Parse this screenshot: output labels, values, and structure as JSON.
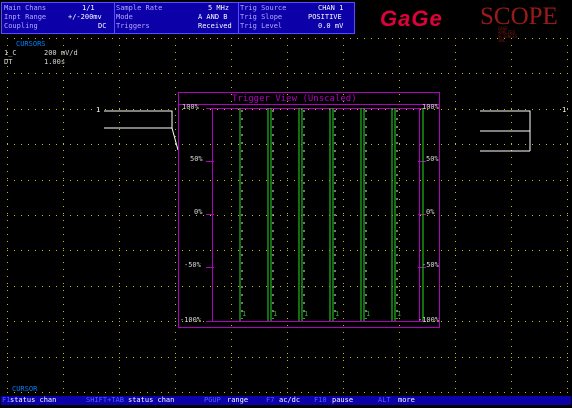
{
  "status_panel": {
    "rows": [
      {
        "c1_label": "Main Chans",
        "c1_value": "1/1",
        "c2_label": "Sample Rate",
        "c2_value": "5 MHz",
        "c3_label": "Trig Source",
        "c3_value": "CHAN 1"
      },
      {
        "c1_label": "Inpt Range",
        "c1_value": "+/-200mv",
        "c2_label": "Mode",
        "c2_value": "A AND B",
        "c3_label": "Trig Slope",
        "c3_value": "POSITIVE"
      },
      {
        "c1_label": "Coupling",
        "c1_value": "DC",
        "c2_label": "Triggers",
        "c2_value": "Received",
        "c3_label": "Trig Level",
        "c3_value": "0.0 mV"
      }
    ]
  },
  "logo": {
    "brand": "GaGe",
    "product": "SCOPE",
    "tagline": "GAGE APPLIED SCIENCES INC."
  },
  "cursors_title": "CURSORS",
  "readouts": [
    {
      "label": "1_C",
      "value": "200 mV/d"
    },
    {
      "label": "DT",
      "value": "1.00s"
    }
  ],
  "channel_marker": "1",
  "trigger_view": {
    "title": "Trigger View (Unscaled)",
    "y_labels": [
      "100%",
      "50%",
      "0%",
      "-50%",
      "-100%"
    ],
    "pulse_count": 6,
    "bottom_markers": [
      "1",
      "1",
      "1",
      "1",
      "1",
      "1"
    ]
  },
  "bottom_cursor_label": "CURSOR",
  "help_bar": [
    {
      "key": "F1",
      "desc": "status chan"
    },
    {
      "key": "SHIFT+TAB",
      "desc": "status chan"
    },
    {
      "key": "PGUP",
      "desc": "range"
    },
    {
      "key": "F7",
      "desc": "ac/dc"
    },
    {
      "key": "F10",
      "desc": "pause"
    },
    {
      "key": "ALT",
      "desc": "more"
    }
  ],
  "colors": {
    "panel_bg": "#0c00a8",
    "grid_dots": "#c8c000",
    "trace": "#ffffff",
    "trigger_frame": "#b000c0",
    "pulse": "#1db81d",
    "logo_red": "#e0003a"
  }
}
